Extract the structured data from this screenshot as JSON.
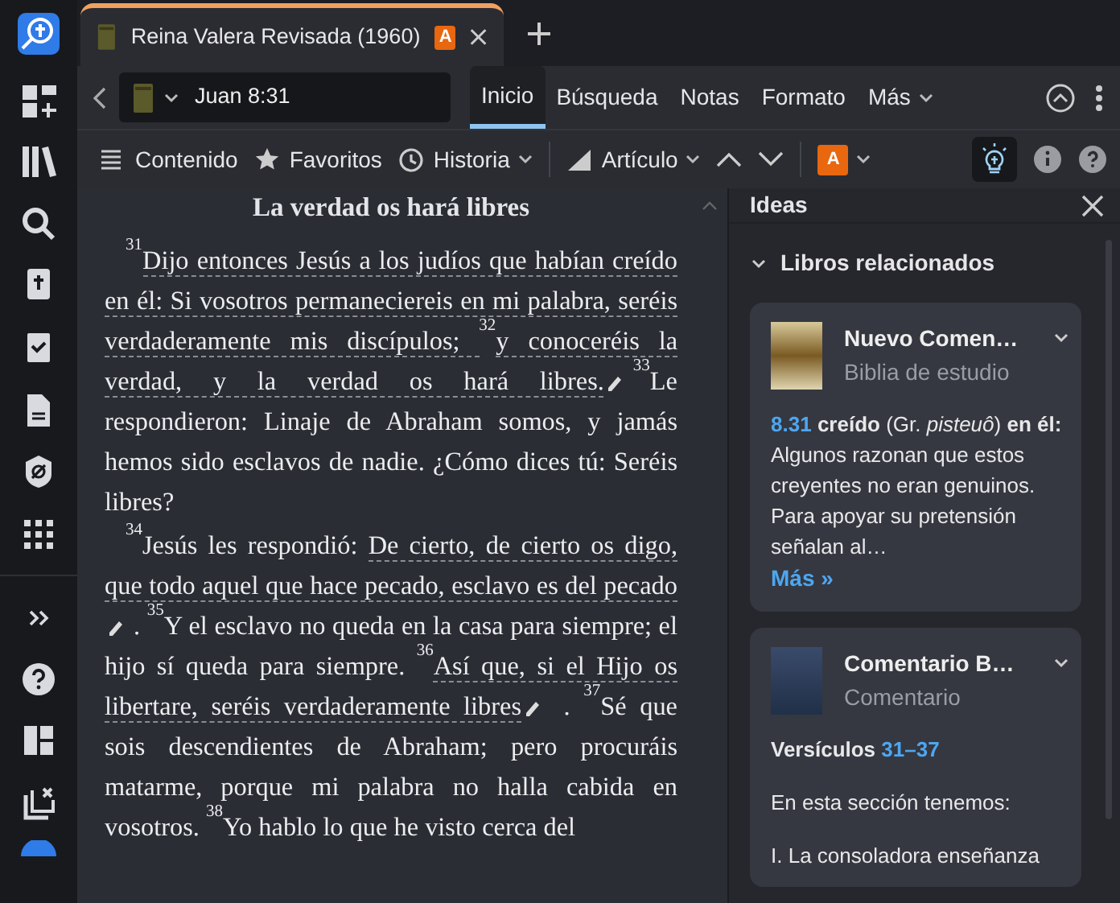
{
  "doc_tab": {
    "title": "Reina Valera Revisada (1960)",
    "badge": "A"
  },
  "reference": "Juan 8:31",
  "nav_tabs": [
    {
      "label": "Inicio",
      "selected": true,
      "has_menu": false
    },
    {
      "label": "Búsqueda",
      "selected": false,
      "has_menu": false
    },
    {
      "label": "Notas",
      "selected": false,
      "has_menu": false
    },
    {
      "label": "Formato",
      "selected": false,
      "has_menu": false
    },
    {
      "label": "Más",
      "selected": false,
      "has_menu": true
    }
  ],
  "toolbar": [
    {
      "kind": "list",
      "label": "Contenido",
      "has_menu": false
    },
    {
      "kind": "star",
      "label": "Favoritos",
      "has_menu": false
    },
    {
      "kind": "clock",
      "label": "Historia",
      "has_menu": true
    },
    {
      "kind": "bars",
      "label": "Artículo",
      "has_menu": true
    }
  ],
  "font_badge": "A",
  "ideas_active": true,
  "document": {
    "title": "La verdad os hará libres",
    "paragraphs": [
      [
        {
          "kind": "verse",
          "text": "31"
        },
        {
          "kind": "text",
          "text": "Dijo entonces Jesús a los judíos que habían creído en él: Si vosotros permaneciereis en mi palabra, seréis verdaderamente mis discípulos; ",
          "underlined": true
        },
        {
          "kind": "verse",
          "text": "32"
        },
        {
          "kind": "text",
          "text": "y conoceréis la verdad, y la verdad os hará libres.",
          "underlined": true
        },
        {
          "kind": "note"
        },
        {
          "kind": "verse",
          "text": "33"
        },
        {
          "kind": "text",
          "text": "Le respondieron: Linaje de Abraham somos, y jamás hemos sido esclavos de nadie. ¿Cómo dices tú: Seréis libres?",
          "underlined": false
        }
      ],
      [
        {
          "kind": "verse",
          "text": "34"
        },
        {
          "kind": "text",
          "text": "Jesús les respondió: ",
          "underlined": false
        },
        {
          "kind": "text",
          "text": "De cierto, de cierto os digo, que todo aquel que hace pecado, esclavo es del pecado",
          "underlined": true
        },
        {
          "kind": "note"
        },
        {
          "kind": "text",
          "text": ". ",
          "underlined": false
        },
        {
          "kind": "verse",
          "text": "35"
        },
        {
          "kind": "text",
          "text": "Y el esclavo no queda en la casa para siempre; el hijo sí queda para siempre. ",
          "underlined": false
        },
        {
          "kind": "verse",
          "text": "36"
        },
        {
          "kind": "text",
          "text": "Así que, si el Hijo os libertare, seréis verdaderamente libres",
          "underlined": true
        },
        {
          "kind": "note"
        },
        {
          "kind": "text",
          "text": " . ",
          "underlined": false
        },
        {
          "kind": "verse",
          "text": "37"
        },
        {
          "kind": "text",
          "text": "Sé que sois descendientes de Abraham; pero procuráis matarme, porque mi palabra no halla cabida en vosotros. ",
          "underlined": false
        },
        {
          "kind": "verse",
          "text": "38"
        },
        {
          "kind": "text",
          "text": "Yo hablo lo que he visto cerca del",
          "underlined": false
        }
      ]
    ]
  },
  "ideas_panel": {
    "title": "Ideas",
    "section": {
      "title": "Libros relacionados",
      "expanded": true
    },
    "cards": [
      {
        "kind": "excerpt",
        "title": "Nuevo Comen…",
        "subtitle": "Biblia de estudio",
        "ref": "8.31",
        "text": "**creído** (Gr. *pisteuô*) **en él:** Algunos razonan que estos creyentes no eran genuinos. Para apoyar su pretensión señalan al…",
        "more": "Más »"
      },
      {
        "kind": "sections",
        "title": "Comentario B…",
        "subtitle": "Comentario",
        "heading": "Versículos",
        "range": "31–37",
        "lines": [
          "En esta sección tenemos:",
          "I. La consoladora enseñanza"
        ]
      }
    ]
  }
}
